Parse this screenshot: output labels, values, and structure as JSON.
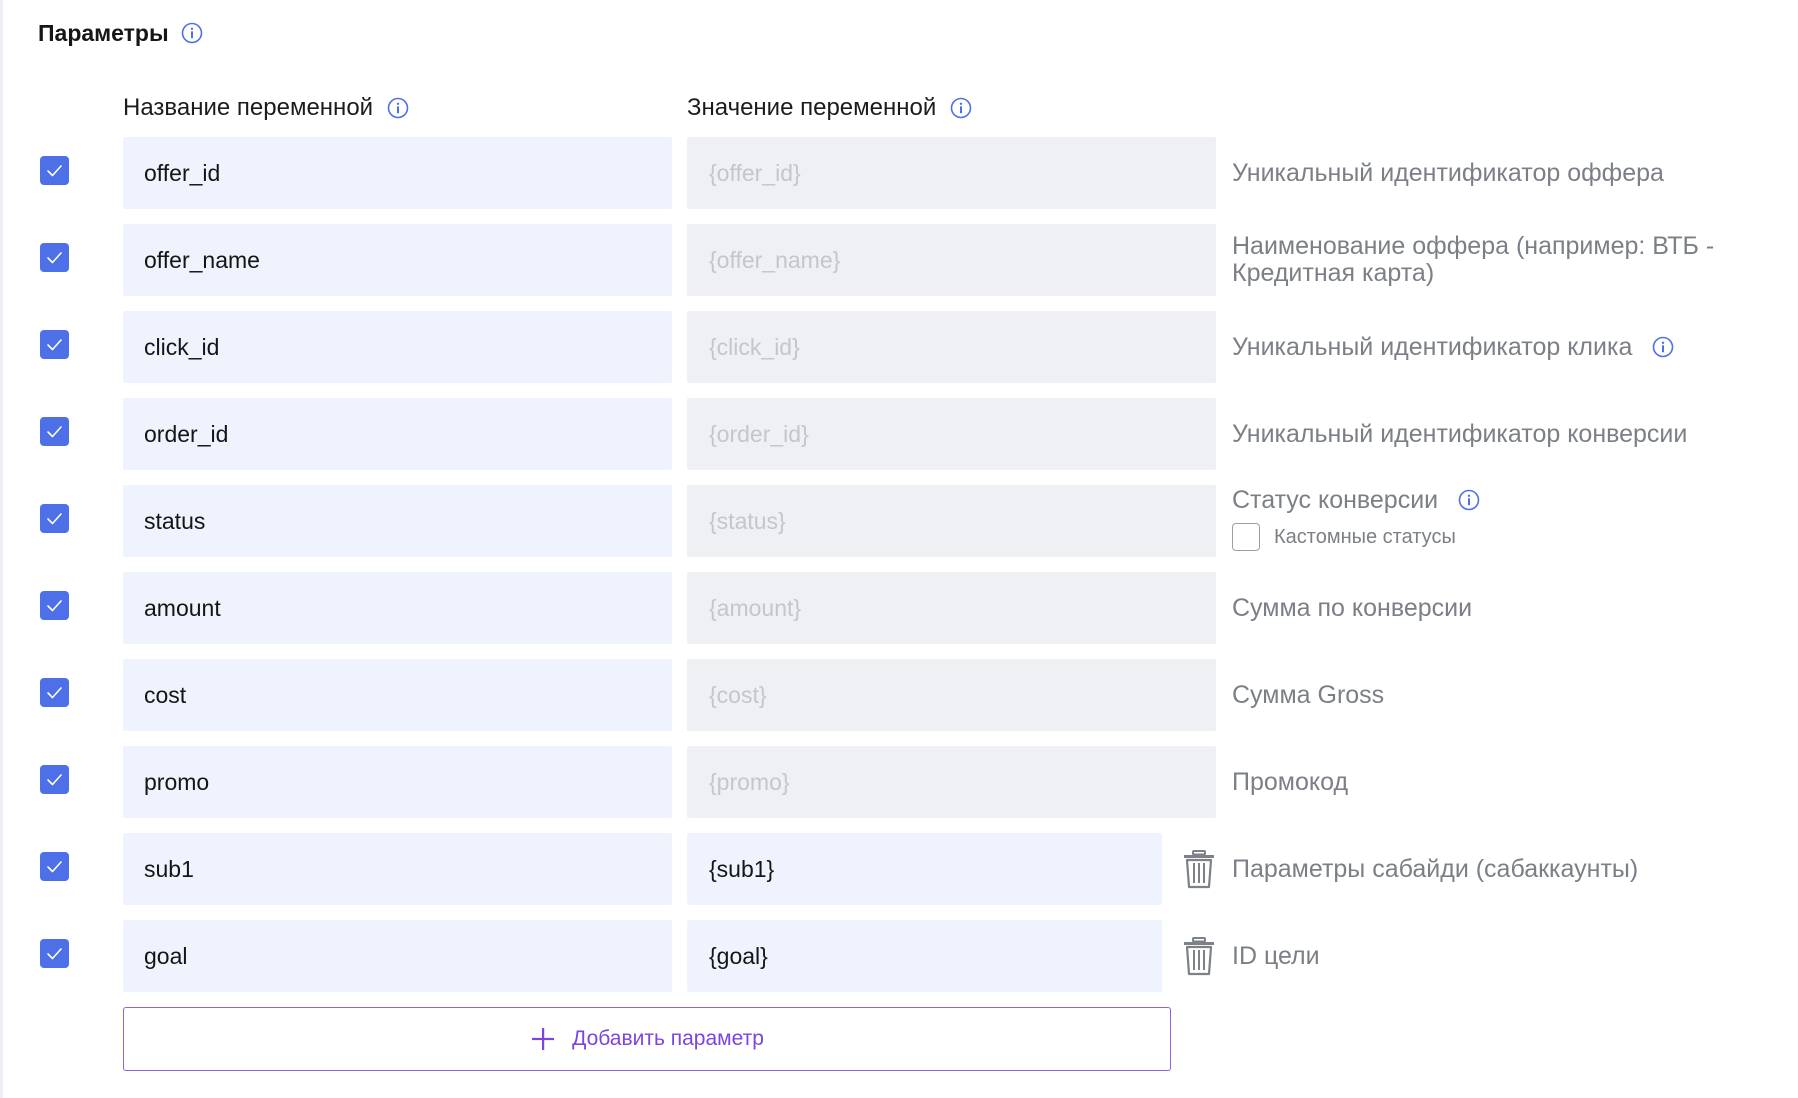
{
  "section": {
    "title": "Параметры",
    "columns": {
      "name_header": "Название переменной",
      "value_header": "Значение переменной"
    },
    "add_button_label": "Добавить параметр",
    "custom_statuses_label": "Кастомные статусы",
    "custom_statuses_checked": false,
    "rows": [
      {
        "checked": true,
        "name": "offer_id",
        "value": "{offer_id}",
        "value_editable": false,
        "description": "Уникальный идентификатор оффера",
        "has_info": false,
        "deletable": false
      },
      {
        "checked": true,
        "name": "offer_name",
        "value": "{offer_name}",
        "value_editable": false,
        "description": "Наименование оффера (например: ВТБ - Кредитная карта)",
        "has_info": false,
        "deletable": false
      },
      {
        "checked": true,
        "name": "click_id",
        "value": "{click_id}",
        "value_editable": false,
        "description": "Уникальный идентификатор клика",
        "has_info": true,
        "deletable": false
      },
      {
        "checked": true,
        "name": "order_id",
        "value": "{order_id}",
        "value_editable": false,
        "description": "Уникальный идентификатор конверсии",
        "has_info": false,
        "deletable": false
      },
      {
        "checked": true,
        "name": "status",
        "value": "{status}",
        "value_editable": false,
        "description": "Статус конверсии",
        "has_info": true,
        "deletable": false
      },
      {
        "checked": true,
        "name": "amount",
        "value": "{amount}",
        "value_editable": false,
        "description": "Сумма по конверсии",
        "has_info": false,
        "deletable": false
      },
      {
        "checked": true,
        "name": "cost",
        "value": "{cost}",
        "value_editable": false,
        "description": "Сумма Gross",
        "has_info": false,
        "deletable": false
      },
      {
        "checked": true,
        "name": "promo",
        "value": "{promo}",
        "value_editable": false,
        "description": "Промокод",
        "has_info": false,
        "deletable": false
      },
      {
        "checked": true,
        "name": "sub1",
        "value": "{sub1}",
        "value_editable": true,
        "description": "Параметры сабайди (сабаккаунты)",
        "has_info": false,
        "deletable": true
      },
      {
        "checked": true,
        "name": "goal",
        "value": "{goal}",
        "value_editable": true,
        "description": "ID цели",
        "has_info": false,
        "deletable": true
      }
    ]
  },
  "colors": {
    "accent": "#4d6fe8",
    "button_accent": "#7a45e0",
    "name_field_bg": "#eff3fd",
    "readonly_field_bg": "#eef0f4",
    "description_text": "#7b7f86"
  },
  "icons": {
    "info": "info-circle-icon",
    "checkbox": "checkmark-icon",
    "delete": "trash-icon",
    "add": "plus-icon"
  }
}
